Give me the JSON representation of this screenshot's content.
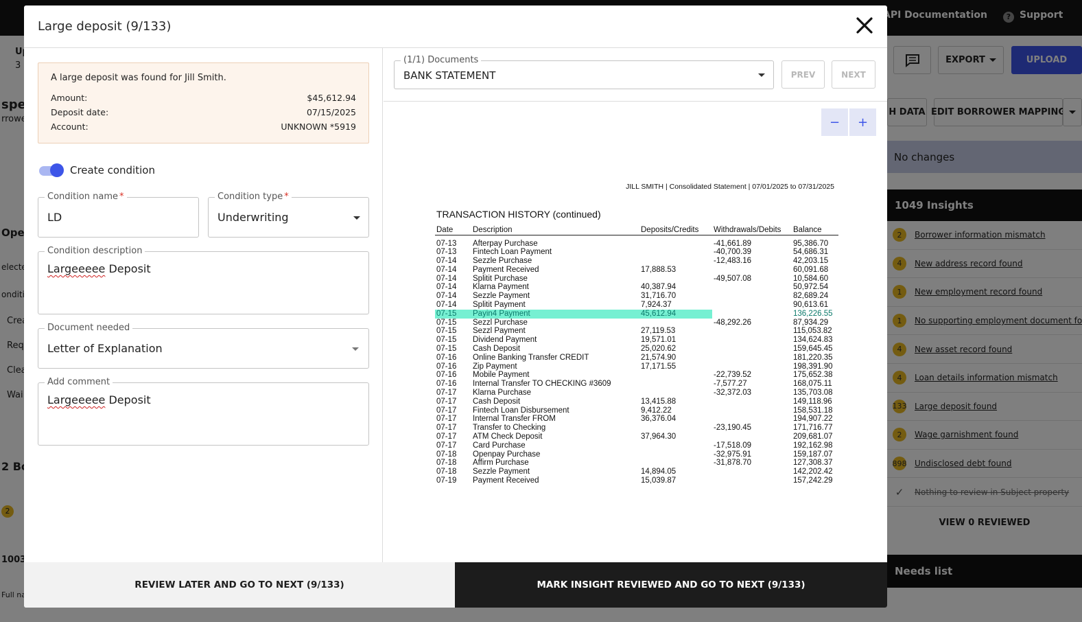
{
  "background": {
    "topbar": {
      "api_docs": "API Documentation",
      "support": "Support"
    },
    "toolbar": {
      "export_label": "EXPORT",
      "upload_label": "UPLOAD"
    },
    "actions": {
      "push_data_label": "H DATA",
      "edit_mapping_label": "EDIT BORROWER MAPPING"
    },
    "no_changes": "No changes",
    "insights_title": "1049 Insights",
    "insights": [
      {
        "count": "2",
        "label": "Borrower information mismatch"
      },
      {
        "count": "4",
        "label": "New address record found"
      },
      {
        "count": "1",
        "label": "New employment record found"
      },
      {
        "count": "1",
        "label": "No supporting employment document fo"
      },
      {
        "count": "4",
        "label": "New asset record found"
      },
      {
        "count": "4",
        "label": "Loan details information mismatch"
      },
      {
        "count": "133",
        "label": "Large deposit found"
      },
      {
        "count": "2",
        "label": "Wage garnishment found"
      },
      {
        "count": "898",
        "label": "Undisclosed debt found"
      }
    ],
    "reviewed_item": "Nothing to review in Subject property",
    "view_reviewed": "VIEW 0 REVIEWED",
    "needs_list": "Needs list",
    "left_fragments": [
      "Up",
      "3",
      "spect",
      "rrowe",
      "Open",
      "electe",
      "onditi",
      "Crea",
      "Req",
      "Clea",
      "Wai",
      "2 Bo",
      "2",
      "1003",
      "Full na"
    ]
  },
  "modal": {
    "title": "Large deposit (9/133)",
    "alert": {
      "message": "A large deposit was found for Jill Smith.",
      "rows": [
        {
          "label": "Amount:",
          "value": "$45,612.94"
        },
        {
          "label": "Deposit date:",
          "value": "07/15/2025"
        },
        {
          "label": "Account:",
          "value": "UNKNOWN *5919"
        }
      ]
    },
    "create_condition": {
      "label": "Create condition",
      "enabled": true
    },
    "condition_name": {
      "label": "Condition name",
      "required_mark": "*",
      "value": "LD"
    },
    "condition_type": {
      "label": "Condition type",
      "required_mark": "*",
      "value": "Underwriting"
    },
    "condition_description": {
      "label": "Condition description",
      "word1": "Largeeeee",
      "word2": "Deposit"
    },
    "document_needed": {
      "label": "Document needed",
      "value": "Letter of Explanation"
    },
    "add_comment": {
      "label": "Add comment",
      "word1": "Largeeeee",
      "word2": "Deposit"
    },
    "documents": {
      "label": "(1/1) Documents",
      "selected": "BANK STATEMENT",
      "prev": "PREV",
      "next": "NEXT"
    },
    "zoom": {
      "minus": "−",
      "plus": "+"
    },
    "statement": {
      "header": "JILL SMITH  |  Consolidated Statement  |  07/01/2025 to 07/31/2025",
      "title": "TRANSACTION HISTORY (continued)",
      "columns": [
        "Date",
        "Description",
        "Deposits/Credits",
        "Withdrawals/Debits",
        "Balance"
      ],
      "highlight_index": 8,
      "rows": [
        [
          "07-13",
          "Afterpay Purchase",
          "",
          "-41,661.89",
          "95,386.70"
        ],
        [
          "07-13",
          "Fintech Loan Payment",
          "",
          "-40,700.39",
          "54,686.31"
        ],
        [
          "07-14",
          "Sezzle Purchase",
          "",
          "-12,483.16",
          "42,203.15"
        ],
        [
          "07-14",
          "Payment Received",
          "17,888.53",
          "",
          "60,091.68"
        ],
        [
          "07-14",
          "Splitit Purchase",
          "",
          "-49,507.08",
          "10,584.60"
        ],
        [
          "07-14",
          "Klarna Payment",
          "40,387.94",
          "",
          "50,972.54"
        ],
        [
          "07-14",
          "Sezzle Payment",
          "31,716.70",
          "",
          "82,689.24"
        ],
        [
          "07-14",
          "Splitit Payment",
          "7,924.37",
          "",
          "90,613.61"
        ],
        [
          "07-15",
          "Payin4 Payment",
          "45,612.94",
          "",
          "136,226.55"
        ],
        [
          "07-15",
          "Sezzl Purchase",
          "",
          "-48,292.26",
          "87,934.29"
        ],
        [
          "07-15",
          "Sezzl Payment",
          "27,119.53",
          "",
          "115,053.82"
        ],
        [
          "07-15",
          "Dividend Payment",
          "19,571.01",
          "",
          "134,624.83"
        ],
        [
          "07-15",
          "Cash Deposit",
          "25,020.62",
          "",
          "159,645.45"
        ],
        [
          "07-16",
          "Online Banking Transfer CREDIT",
          "21,574.90",
          "",
          "181,220.35"
        ],
        [
          "07-16",
          "Zip Payment",
          "17,171.55",
          "",
          "198,391.90"
        ],
        [
          "07-16",
          "Mobile Payment",
          "",
          "-22,739.52",
          "175,652.38"
        ],
        [
          "07-16",
          "Internal Transfer TO CHECKING #3609",
          "",
          "-7,577.27",
          "168,075.11"
        ],
        [
          "07-17",
          "Klarna Purchase",
          "",
          "-32,372.03",
          "135,703.08"
        ],
        [
          "07-17",
          "Cash Deposit",
          "13,415.88",
          "",
          "149,118.96"
        ],
        [
          "07-17",
          "Fintech Loan Disbursement",
          "9,412.22",
          "",
          "158,531.18"
        ],
        [
          "07-17",
          "Internal Transfer FROM",
          "36,376.04",
          "",
          "194,907.22"
        ],
        [
          "07-17",
          "Transfer to Checking",
          "",
          "-23,190.45",
          "171,716.77"
        ],
        [
          "07-17",
          "ATM Check Deposit",
          "37,964.30",
          "",
          "209,681.07"
        ],
        [
          "07-17",
          "Card Purchase",
          "",
          "-17,518.09",
          "192,162.98"
        ],
        [
          "07-18",
          "Openpay Purchase",
          "",
          "-32,975.91",
          "159,187.07"
        ],
        [
          "07-18",
          "Affirm Purchase",
          "",
          "-31,878.70",
          "127,308.37"
        ],
        [
          "07-18",
          "Sezzle Payment",
          "14,894.05",
          "",
          "142,202.42"
        ],
        [
          "07-19",
          "Payment Received",
          "15,039.87",
          "",
          "157,242.29"
        ]
      ]
    },
    "footer": {
      "review_later": "REVIEW LATER AND GO TO NEXT (9/133)",
      "mark_reviewed": "MARK INSIGHT REVIEWED AND GO TO NEXT (9/133)"
    }
  }
}
